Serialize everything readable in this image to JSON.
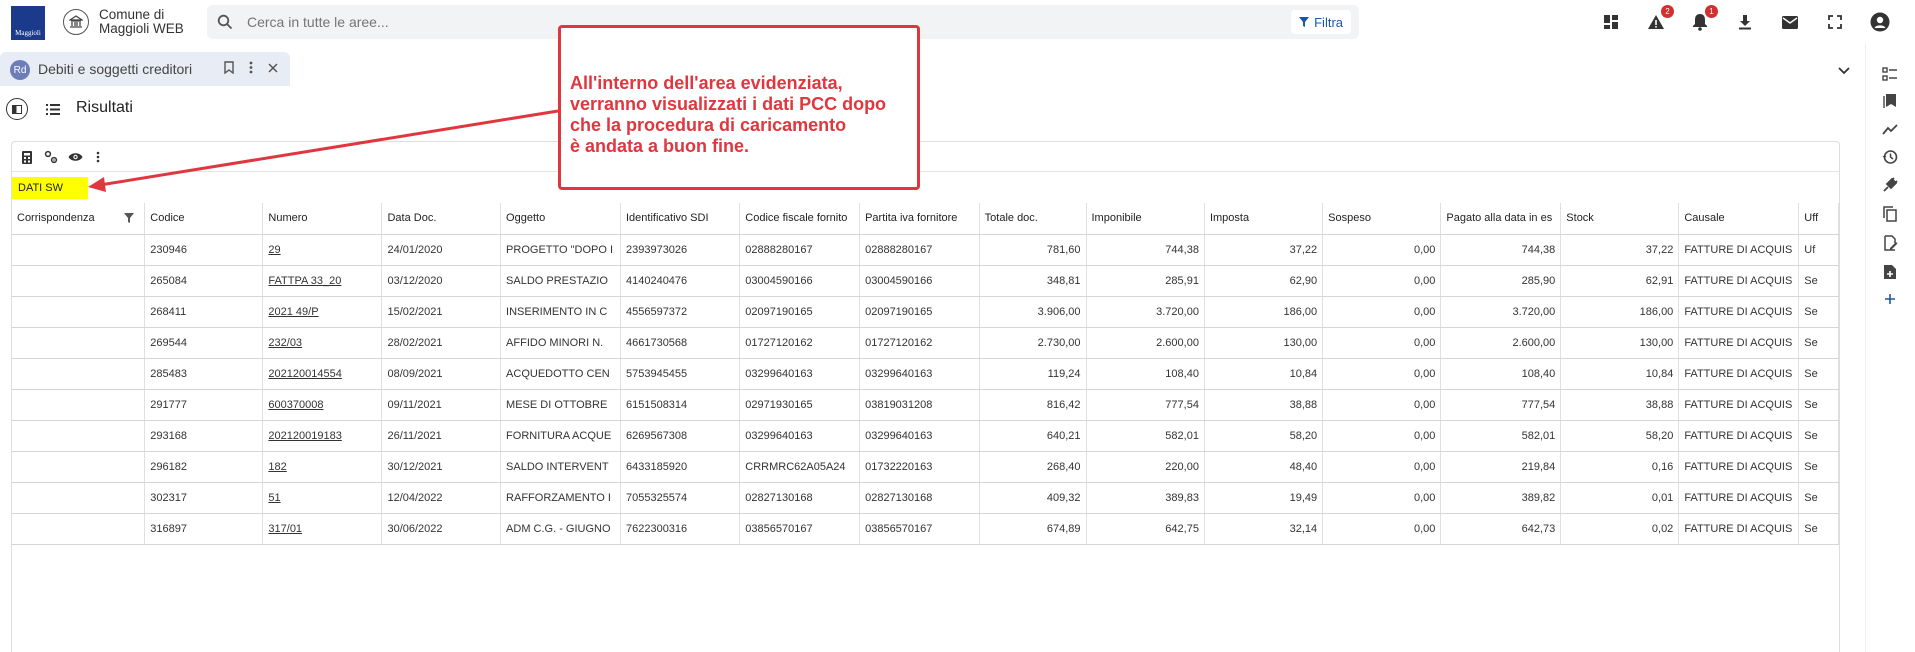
{
  "app": {
    "logo_text": "Maggioli",
    "name": "Comune di Maggioli WEB"
  },
  "search": {
    "placeholder": "Cerca in tutte le aree...",
    "filter_label": "Filtra"
  },
  "toolbar_icons": [
    {
      "name": "dashboard-icon"
    },
    {
      "name": "warning-icon",
      "badge": "2"
    },
    {
      "name": "bell-icon",
      "badge": "1"
    },
    {
      "name": "download-icon"
    },
    {
      "name": "mail-icon"
    },
    {
      "name": "fullscreen-icon"
    },
    {
      "name": "user-icon"
    }
  ],
  "tab": {
    "icon_text": "Rd",
    "label": "Debiti e soggetti creditori"
  },
  "results": {
    "title": "Risultati"
  },
  "highlight_label": "DATI SW",
  "callout": {
    "line1": "All'interno dell'area evidenziata,",
    "line2": "verranno visualizzati i dati PCC dopo",
    "line3": "che la procedura di caricamento",
    "line4": "è andata a buon fine.",
    "color": "#e0373f"
  },
  "table": {
    "columns": [
      "Corrispondenza",
      "Codice",
      "Numero",
      "Data Doc.",
      "Oggetto",
      "Identificativo SDI",
      "Codice fiscale fornito",
      "Partita iva fornitore",
      "Totale doc.",
      "Imponibile",
      "Imposta",
      "Sospeso",
      "Pagato alla data in es",
      "Stock",
      "Causale",
      "Uff"
    ],
    "rows": [
      [
        "",
        "230946",
        "29",
        "24/01/2020",
        "PROGETTO \"DOPO I",
        "2393973026",
        "02888280167",
        "02888280167",
        "781,60",
        "744,38",
        "37,22",
        "0,00",
        "744,38",
        "37,22",
        "FATTURE DI ACQUIS",
        "Uf"
      ],
      [
        "",
        "265084",
        "FATTPA 33_20",
        "03/12/2020",
        "SALDO PRESTAZIO",
        "4140240476",
        "03004590166",
        "03004590166",
        "348,81",
        "285,91",
        "62,90",
        "0,00",
        "285,90",
        "62,91",
        "FATTURE DI ACQUIS",
        "Se"
      ],
      [
        "",
        "268411",
        "2021 49/P",
        "15/02/2021",
        "INSERIMENTO IN C",
        "4556597372",
        "02097190165",
        "02097190165",
        "3.906,00",
        "3.720,00",
        "186,00",
        "0,00",
        "3.720,00",
        "186,00",
        "FATTURE DI ACQUIS",
        "Se"
      ],
      [
        "",
        "269544",
        "232/03",
        "28/02/2021",
        "AFFIDO MINORI N.",
        "4661730568",
        "01727120162",
        "01727120162",
        "2.730,00",
        "2.600,00",
        "130,00",
        "0,00",
        "2.600,00",
        "130,00",
        "FATTURE DI ACQUIS",
        "Se"
      ],
      [
        "",
        "285483",
        "202120014554",
        "08/09/2021",
        "ACQUEDOTTO CEN",
        "5753945455",
        "03299640163",
        "03299640163",
        "119,24",
        "108,40",
        "10,84",
        "0,00",
        "108,40",
        "10,84",
        "FATTURE DI ACQUIS",
        "Se"
      ],
      [
        "",
        "291777",
        "600370008",
        "09/11/2021",
        "MESE DI OTTOBRE",
        "6151508314",
        "02971930165",
        "03819031208",
        "816,42",
        "777,54",
        "38,88",
        "0,00",
        "777,54",
        "38,88",
        "FATTURE DI ACQUIS",
        "Se"
      ],
      [
        "",
        "293168",
        "202120019183",
        "26/11/2021",
        "FORNITURA ACQUE",
        "6269567308",
        "03299640163",
        "03299640163",
        "640,21",
        "582,01",
        "58,20",
        "0,00",
        "582,01",
        "58,20",
        "FATTURE DI ACQUIS",
        "Se"
      ],
      [
        "",
        "296182",
        "182",
        "30/12/2021",
        "SALDO INTERVENT",
        "6433185920",
        "CRRMRC62A05A24",
        "01732220163",
        "268,40",
        "220,00",
        "48,40",
        "0,00",
        "219,84",
        "0,16",
        "FATTURE DI ACQUIS",
        "Se"
      ],
      [
        "",
        "302317",
        "51",
        "12/04/2022",
        "RAFFORZAMENTO I",
        "7055325574",
        "02827130168",
        "02827130168",
        "409,32",
        "389,83",
        "19,49",
        "0,00",
        "389,82",
        "0,01",
        "FATTURE DI ACQUIS",
        "Se"
      ],
      [
        "",
        "316897",
        "317/01",
        "30/06/2022",
        "ADM C.G. - GIUGNO",
        "7622300316",
        "03856570167",
        "03856570167",
        "674,89",
        "642,75",
        "32,14",
        "0,00",
        "642,73",
        "0,02",
        "FATTURE DI ACQUIS",
        "Se"
      ]
    ]
  }
}
